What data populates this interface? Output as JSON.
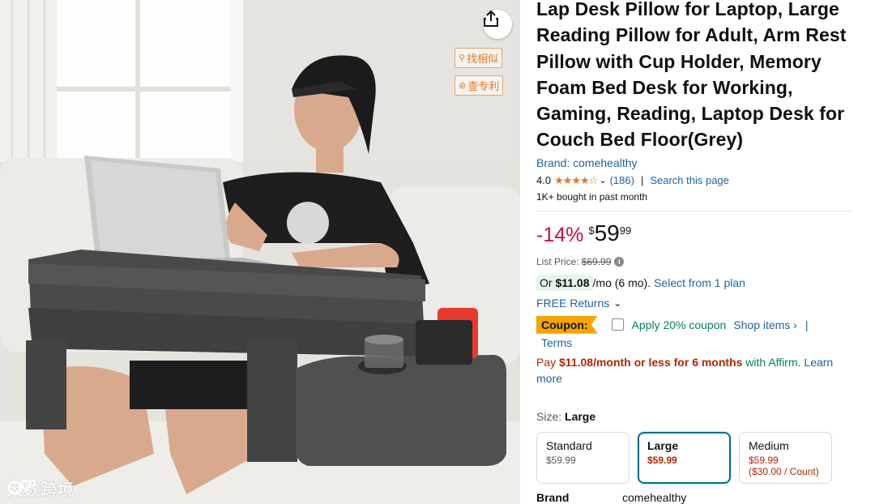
{
  "image_overlay": {
    "search_similar": "找相似",
    "check_patent": "查专利",
    "watermark": "大数跨境"
  },
  "product": {
    "title": "Lap Desk Pillow for Laptop, Large Reading Pillow for Adult, Arm Rest Pillow with Cup Holder, Memory Foam Bed Desk for Working, Gaming, Reading, Laptop Desk for Couch Bed Floor(Grey)",
    "brand_link": "Brand: comehealthy",
    "rating": "4.0",
    "stars": "★★★★☆",
    "review_count": "(186)",
    "search_page": "Search this page",
    "separator": "|",
    "bought": "1K+ bought in past month"
  },
  "price": {
    "discount": "-14%",
    "symbol": "$",
    "whole": "59",
    "fraction": "99",
    "list_label": "List Price:",
    "list_value": "$69.99",
    "monthly_or": "Or",
    "monthly_amount": "$11.08",
    "monthly_rest": "/mo (6 mo).",
    "select_plan": "Select from 1 plan",
    "returns": "FREE Returns",
    "coupon_badge": "Coupon:",
    "coupon_text": "Apply 20% coupon",
    "shop_items": "Shop items ›",
    "pipe": "|",
    "terms": "Terms",
    "affirm_pay": "Pay ",
    "affirm_amount": "$11.08/month or less for 6 months",
    "affirm_with": " with Affirm.",
    "affirm_learn": " Learn more"
  },
  "size": {
    "label": "Size:",
    "selected": "Large",
    "options": [
      {
        "name": "Standard",
        "price": "$59.99",
        "unit": ""
      },
      {
        "name": "Large",
        "price": "$59.99",
        "unit": ""
      },
      {
        "name": "Medium",
        "price": "$59.99",
        "unit": "($30.00 / Count)"
      }
    ]
  },
  "specs": {
    "brand_key": "Brand",
    "brand_value": "comehealthy"
  },
  "colors": {
    "link": "#2162a1",
    "deal_red": "#CC0C39",
    "price_red": "#B12704",
    "coupon_orange": "#f7a300",
    "star": "#de7921",
    "green": "#067D62"
  }
}
